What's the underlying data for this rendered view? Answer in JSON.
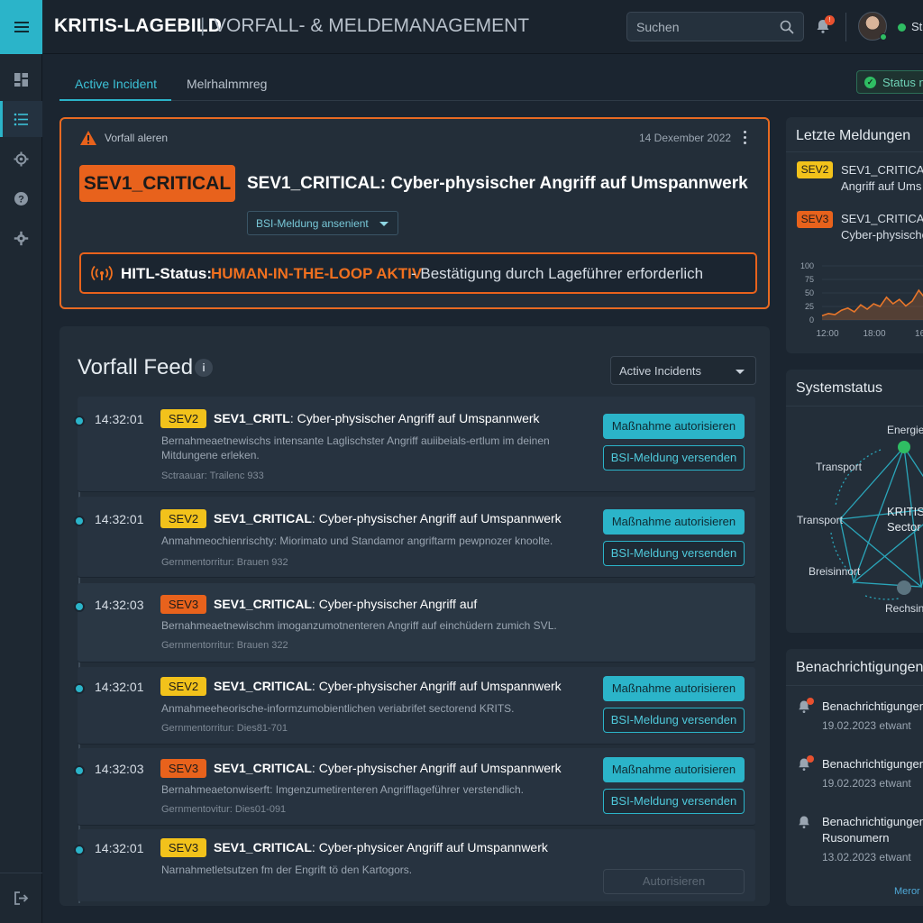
{
  "header": {
    "title": "KRITIS-LAGEBILD",
    "separator": "|",
    "subtitle": "VORFALL- & MELDEMANAGEMENT",
    "search_placeholder": "Suchen",
    "notification_badge": "!",
    "status_label": "St"
  },
  "sidebar": {
    "items": [
      {
        "icon": "dashboard-icon",
        "active": false
      },
      {
        "icon": "list-icon",
        "active": true
      },
      {
        "icon": "gear-cog-icon",
        "active": false
      },
      {
        "icon": "help-icon",
        "active": false
      },
      {
        "icon": "settings-icon",
        "active": false
      }
    ],
    "bottom_icon": "logout-icon"
  },
  "tabs": [
    {
      "label": "Active Incident",
      "active": true
    },
    {
      "label": "Melrhalmmreg",
      "active": false
    }
  ],
  "status_button": {
    "label": "Status n"
  },
  "alert": {
    "kicker": "Vorfall aleren",
    "date": "14 Dexember 2022",
    "severity": "SEV1_CRITICAL",
    "title": "SEV1_CRITICAL: Cyber-physischer Angriff auf Umspannwerk",
    "bsi_select": "BSI-Meldung ansenient",
    "hitl_label": "HITL-Status:",
    "hitl_active": "HUMAN-IN-THE-LOOP AKTIV",
    "hitl_desc": "- Bestätigung durch Lageführer erforderlich"
  },
  "feed": {
    "title": "Vorfall Feed",
    "filter": "Active Incidents",
    "items": [
      {
        "time": "14:32:01",
        "sev": "SEV2",
        "sev_level": "sev2",
        "title_bold": "SEV1_CRITL",
        "title_rest": ": Cyber-physischer Angriff auf Umspannwerk",
        "desc": "Bernahmeaetnewischs intensante Laglischster Angriff auiibeials-ertlum im deinen Mitdungene erleken.",
        "meta": "Sctraauar: Trailenc 933",
        "primary": "Maßnahme autorisieren",
        "secondary": "BSI-Meldung versenden"
      },
      {
        "time": "14:32:01",
        "sev": "SEV2",
        "sev_level": "sev2",
        "title_bold": "SEV1_CRITICAL",
        "title_rest": ": Cyber-physischer Angriff auf Umspannwerk",
        "desc": "Anmahmeochienrischty: Miorimato und Standamor angriftarm pewpnozer knoolte.",
        "meta": "Gernmentorritur: Brauen 932",
        "primary": "Maßnahme autorisieren",
        "secondary": "BSI-Meldung versenden"
      },
      {
        "time": "14:32:03",
        "sev": "SEV3",
        "sev_level": "sev3",
        "title_bold": "SEV1_CRITICAL",
        "title_rest": ": Cyber-physischer Angriff auf",
        "desc": "Bernahmeaetnewischm imoganzumotnenteren Angriff auf einchüdern zumich SVL.",
        "meta": "Gernmentorritur: Brauen 322",
        "primary": "",
        "secondary": ""
      },
      {
        "time": "14:32:01",
        "sev": "SEV2",
        "sev_level": "sev2",
        "title_bold": "SEV1_CRITICAL",
        "title_rest": ": Cyber-physischer Angriff auf Umspannwerk",
        "desc": "Anmahmeeheorische-informzumobientlichen veriabrifet sectorend KRITS.",
        "meta": "Gernmentorritur: Dies81-701",
        "primary": "Maßnahme autorisieren",
        "secondary": "BSI-Meldung versenden"
      },
      {
        "time": "14:32:03",
        "sev": "SEV3",
        "sev_level": "sev3",
        "title_bold": "SEV1_CRITICAL",
        "title_rest": ": Cyber-physischer Angriff auf Umspannwerk",
        "desc": "Bernahmeaetonwiserft: Imgenzumetirenteren Angrifflageführer verstendlich.",
        "meta": "Gernmentovitur: Dies01-091",
        "primary": "Maßnahme autorisieren",
        "secondary": "BSI-Meldung versenden"
      },
      {
        "time": "14:32:01",
        "sev": "SEV3",
        "sev_level": "sev2",
        "title_bold": "SEV1_CRITICAL",
        "title_rest": ": Cyber-physicer Angriff auf Umspannwerk",
        "desc": "Narnahmetletsutzen fm der Engrift tö den Kartogors.",
        "meta": "",
        "primary": "",
        "secondary": "Autorisieren"
      }
    ]
  },
  "latest": {
    "title": "Letzte Meldungen",
    "items": [
      {
        "sev": "SEV2",
        "line1": "SEV1_CRITICAL",
        "line2": "Angriff auf Ums"
      },
      {
        "sev": "SEV3",
        "line1": "SEV1_CRITICAL",
        "line2": "Cyber-physische"
      }
    ]
  },
  "chart_data": {
    "type": "area",
    "x_ticks": [
      "12:00",
      "18:00",
      "16:"
    ],
    "y_ticks": [
      "100",
      "75",
      "50",
      "25",
      "0"
    ],
    "ylim": [
      0,
      100
    ],
    "x": [
      0,
      1,
      2,
      3,
      4,
      5,
      6,
      7,
      8,
      9,
      10,
      11,
      12,
      13,
      14,
      15,
      16,
      17,
      18,
      19,
      20
    ],
    "values": [
      8,
      12,
      10,
      18,
      22,
      15,
      28,
      20,
      30,
      25,
      42,
      30,
      38,
      26,
      35,
      55,
      40,
      72,
      50,
      65,
      58
    ],
    "color": "#e8762a"
  },
  "systemstatus": {
    "title": "Systemstatus",
    "center_line1": "KRITIS",
    "center_line2": "Sector",
    "nodes": [
      "Energie",
      "Transport",
      "Transport",
      "Breisinnort",
      "Rechsin"
    ]
  },
  "notifications": {
    "title": "Benachrichtigungen",
    "items": [
      {
        "title": "Benachrichtigungen",
        "title2": "",
        "time": "19.02.2023 etwant",
        "unread": true
      },
      {
        "title": "Benachrichtigungen",
        "title2": "",
        "time": "19.02.2023 etwant",
        "unread": true
      },
      {
        "title": "Benachrichtigungen",
        "title2": "Rusonumern",
        "time": "13.02.2023 etwant",
        "unread": false
      }
    ],
    "more": "Meror"
  },
  "colors": {
    "accent": "#2bb4c9",
    "critical": "#e8621c",
    "sev2": "#f2c21b",
    "ok": "#2fbd63"
  }
}
